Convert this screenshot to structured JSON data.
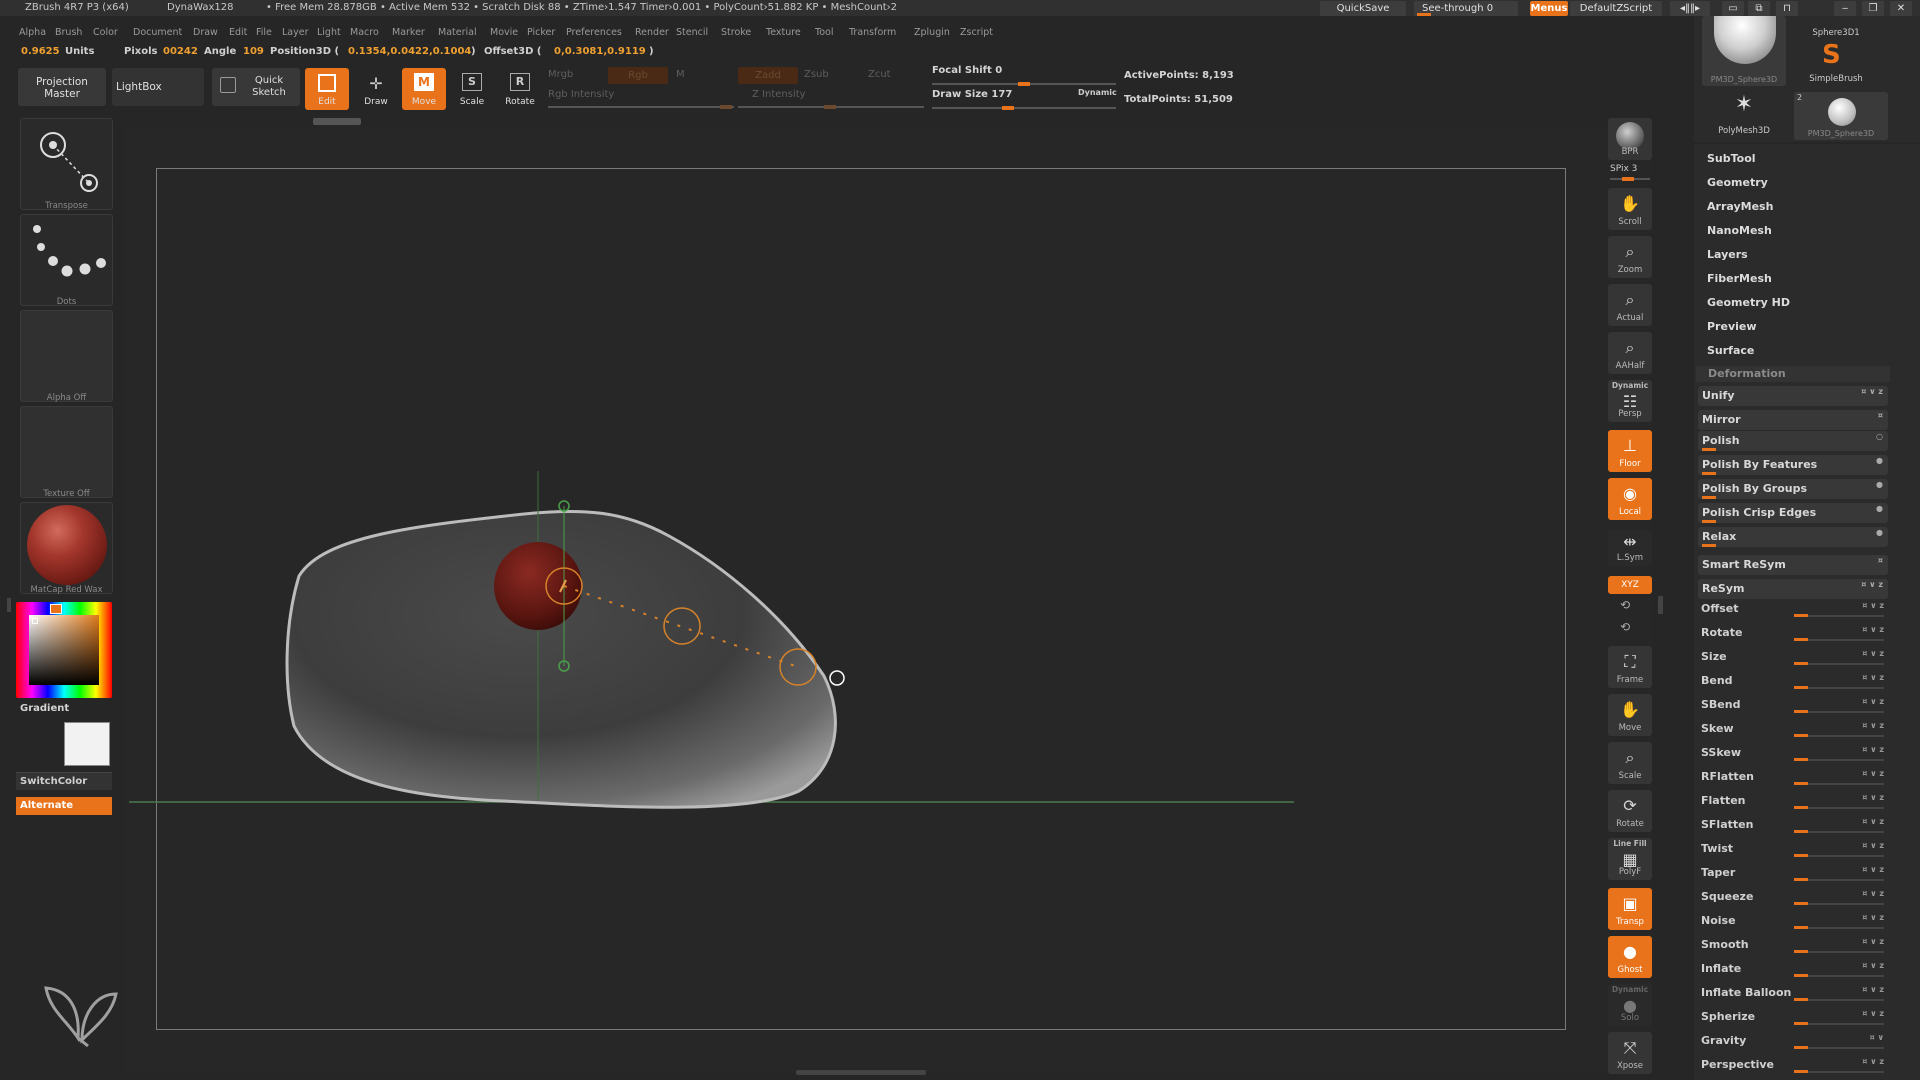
{
  "app": {
    "title": "ZBrush 4R7 P3 (x64)",
    "document": "DynaWax128",
    "stats": "• Free Mem 28.878GB • Active Mem 532 • Scratch Disk 88 •  ZTime›1.547 Timer›0.001 • PolyCount›51.882 KP  • MeshCount›2",
    "quicksave": "QuickSave",
    "seethrough": "See-through  0",
    "menus": "Menus",
    "script": "DefaultZScript"
  },
  "menubar": [
    "Alpha",
    "Brush",
    "Color",
    "Document",
    "Draw",
    "Edit",
    "File",
    "Layer",
    "Light",
    "Macro",
    "Marker",
    "Material",
    "Movie",
    "Picker",
    "Preferences",
    "Render",
    "Stencil",
    "Stroke",
    "Texture",
    "Tool",
    "Transform",
    "Zplugin",
    "Zscript"
  ],
  "infobar": {
    "units_value": "0.9625",
    "units_label": "Units",
    "pixols_label": "Pixols",
    "pixols_value": "00242",
    "angle_label": "Angle",
    "angle_value": "109",
    "pos_label": "Position3D (",
    "pos_value": "0.1354,0.0422,0.1004",
    "pos_close": ")",
    "offset_label": "Offset3D (",
    "offset_value": "0,0.3081,0.9119",
    "offset_close": ")"
  },
  "toolbar": {
    "projection_master": "Projection Master",
    "lightbox": "LightBox",
    "quick_sketch": "Quick Sketch",
    "edit": "Edit",
    "draw": "Draw",
    "move": "Move",
    "scale": "Scale",
    "rotate": "Rotate",
    "mrgb": "Mrgb",
    "rgb": "Rgb",
    "m": "M",
    "rgb_intensity": "Rgb Intensity",
    "zadd": "Zadd",
    "zsub": "Zsub",
    "zcut": "Zcut",
    "z_intensity": "Z Intensity",
    "focal_shift": "Focal Shift 0",
    "draw_size": "Draw Size 177",
    "dynamic": "Dynamic",
    "active_points": "ActivePoints: 8,193",
    "total_points": "TotalPoints: 51,509"
  },
  "leftpanel": {
    "transpose": "Transpose",
    "dots": "Dots",
    "alpha": "Alpha Off",
    "texture": "Texture Off",
    "material": "MatCap Red Wax",
    "gradient": "Gradient",
    "switchcolor": "SwitchColor",
    "alternate": "Alternate"
  },
  "rightshelf": {
    "bpr": "BPR",
    "spix": "SPix 3",
    "scroll": "Scroll",
    "zoom": "Zoom",
    "actual": "Actual",
    "aahalf": "AAHalf",
    "dynamic": "Dynamic",
    "persp": "Persp",
    "floor": "Floor",
    "local": "Local",
    "lsym": "L.Sym",
    "xyz": "XYZ",
    "frame": "Frame",
    "move": "Move",
    "scale": "Scale",
    "rotate": "Rotate",
    "linefill": "Line Fill",
    "polyf": "PolyF",
    "transp": "Transp",
    "ghost": "Ghost",
    "dynamic2": "Dynamic",
    "solo": "Solo",
    "xpose": "Xpose"
  },
  "tools": {
    "t1": "PM3D_Sphere3D",
    "t2": "SimpleBrush",
    "t2_top": "Sphere3D1",
    "t3": "PolyMesh3D",
    "t4": "PM3D_Sphere3D",
    "t4_count": "2"
  },
  "toolmenu": [
    "SubTool",
    "Geometry",
    "ArrayMesh",
    "NanoMesh",
    "Layers",
    "FiberMesh",
    "Geometry HD",
    "Preview",
    "Surface"
  ],
  "deformation": {
    "header": "Deformation",
    "boxes": [
      {
        "name": "Unify",
        "icons": "¤ ∨ z"
      },
      {
        "name": "Mirror",
        "icons": "¤"
      },
      {
        "name": "Polish",
        "icons": "○"
      },
      {
        "name": "Polish By Features",
        "icons": "●"
      },
      {
        "name": "Polish By Groups",
        "icons": "●"
      },
      {
        "name": "Polish Crisp Edges",
        "icons": "●"
      },
      {
        "name": "Relax",
        "icons": "●"
      },
      {
        "name": "Smart ReSym",
        "icons": "¤"
      },
      {
        "name": "ReSym",
        "icons": "¤ ∨ z"
      }
    ],
    "sliders": [
      {
        "name": "Offset",
        "icons": "¤ ∨ z"
      },
      {
        "name": "Rotate",
        "icons": "¤ ∨ z"
      },
      {
        "name": "Size",
        "icons": "¤ ∨ z"
      },
      {
        "name": "Bend",
        "icons": "¤ ∨ z"
      },
      {
        "name": "SBend",
        "icons": "¤ ∨ z"
      },
      {
        "name": "Skew",
        "icons": "¤ ∨ z"
      },
      {
        "name": "SSkew",
        "icons": "¤ ∨ z"
      },
      {
        "name": "RFlatten",
        "icons": "¤ ∨ z"
      },
      {
        "name": "Flatten",
        "icons": "¤ ∨ z"
      },
      {
        "name": "SFlatten",
        "icons": "¤ ∨ z"
      },
      {
        "name": "Twist",
        "icons": "¤ ∨ z"
      },
      {
        "name": "Taper",
        "icons": "¤ ∨ z"
      },
      {
        "name": "Squeeze",
        "icons": "¤ ∨ z"
      },
      {
        "name": "Noise",
        "icons": "¤ ∨ z"
      },
      {
        "name": "Smooth",
        "icons": "¤ ∨ z"
      },
      {
        "name": "Inflate",
        "icons": "¤ ∨ z"
      },
      {
        "name": "Inflate Balloon",
        "icons": "¤ ∨ z"
      },
      {
        "name": "Spherize",
        "icons": "¤ ∨ z"
      },
      {
        "name": "Gravity",
        "icons": "¤ ∨"
      },
      {
        "name": "Perspective",
        "icons": "¤ ∨ z"
      }
    ]
  },
  "colors": {
    "accent": "#e8731a",
    "background": "#262626",
    "panel": "#303030"
  }
}
